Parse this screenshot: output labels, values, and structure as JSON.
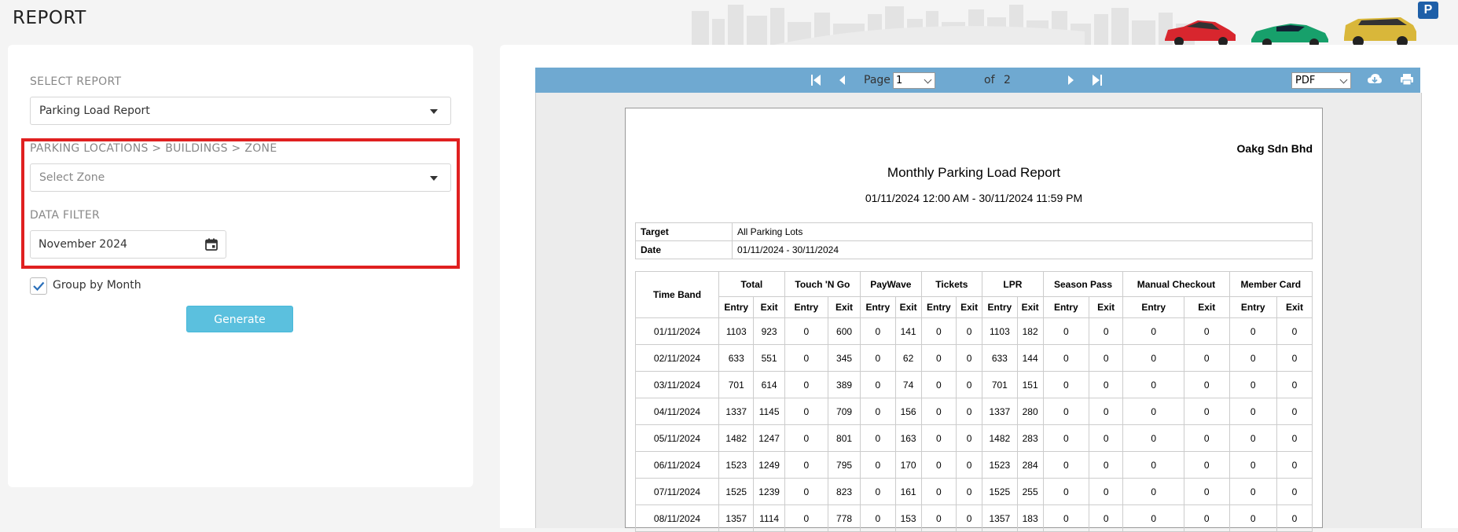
{
  "page": {
    "title": "REPORT"
  },
  "banner": {
    "parking_badge": "P"
  },
  "form": {
    "select_report_label": "SELECT REPORT",
    "select_report_value": "Parking Load Report",
    "location_label": "PARKING LOCATIONS > BUILDINGS > ZONE",
    "zone_placeholder": "Select Zone",
    "data_filter_label": "DATA FILTER",
    "date_value": "November 2024",
    "group_by_label": "Group by Month",
    "group_by_checked": true,
    "generate_label": "Generate"
  },
  "toolbar": {
    "page_label": "Page",
    "page_value": "1",
    "of_label": "of",
    "total_pages": "2",
    "format_value": "PDF"
  },
  "report": {
    "company": "Oakg Sdn Bhd",
    "title": "Monthly Parking Load Report",
    "range": "01/11/2024 12:00 AM - 30/11/2024 11:59 PM",
    "meta": [
      {
        "key": "Target",
        "value": "All Parking Lots"
      },
      {
        "key": "Date",
        "value": "01/11/2024 - 30/11/2024"
      }
    ],
    "time_band_header": "Time Band",
    "groups": [
      "Total",
      "Touch 'N Go",
      "PayWave",
      "Tickets",
      "LPR",
      "Season Pass",
      "Manual Checkout",
      "Member Card"
    ],
    "entry_label": "Entry",
    "exit_label": "Exit",
    "rows": [
      {
        "date": "01/11/2024",
        "cells": [
          "1103",
          "923",
          "0",
          "600",
          "0",
          "141",
          "0",
          "0",
          "1103",
          "182",
          "0",
          "0",
          "0",
          "0",
          "0",
          "0"
        ]
      },
      {
        "date": "02/11/2024",
        "cells": [
          "633",
          "551",
          "0",
          "345",
          "0",
          "62",
          "0",
          "0",
          "633",
          "144",
          "0",
          "0",
          "0",
          "0",
          "0",
          "0"
        ]
      },
      {
        "date": "03/11/2024",
        "cells": [
          "701",
          "614",
          "0",
          "389",
          "0",
          "74",
          "0",
          "0",
          "701",
          "151",
          "0",
          "0",
          "0",
          "0",
          "0",
          "0"
        ]
      },
      {
        "date": "04/11/2024",
        "cells": [
          "1337",
          "1145",
          "0",
          "709",
          "0",
          "156",
          "0",
          "0",
          "1337",
          "280",
          "0",
          "0",
          "0",
          "0",
          "0",
          "0"
        ]
      },
      {
        "date": "05/11/2024",
        "cells": [
          "1482",
          "1247",
          "0",
          "801",
          "0",
          "163",
          "0",
          "0",
          "1482",
          "283",
          "0",
          "0",
          "0",
          "0",
          "0",
          "0"
        ]
      },
      {
        "date": "06/11/2024",
        "cells": [
          "1523",
          "1249",
          "0",
          "795",
          "0",
          "170",
          "0",
          "0",
          "1523",
          "284",
          "0",
          "0",
          "0",
          "0",
          "0",
          "0"
        ]
      },
      {
        "date": "07/11/2024",
        "cells": [
          "1525",
          "1239",
          "0",
          "823",
          "0",
          "161",
          "0",
          "0",
          "1525",
          "255",
          "0",
          "0",
          "0",
          "0",
          "0",
          "0"
        ]
      },
      {
        "date": "08/11/2024",
        "cells": [
          "1357",
          "1114",
          "0",
          "778",
          "0",
          "153",
          "0",
          "0",
          "1357",
          "183",
          "0",
          "0",
          "0",
          "0",
          "0",
          "0"
        ]
      }
    ]
  }
}
